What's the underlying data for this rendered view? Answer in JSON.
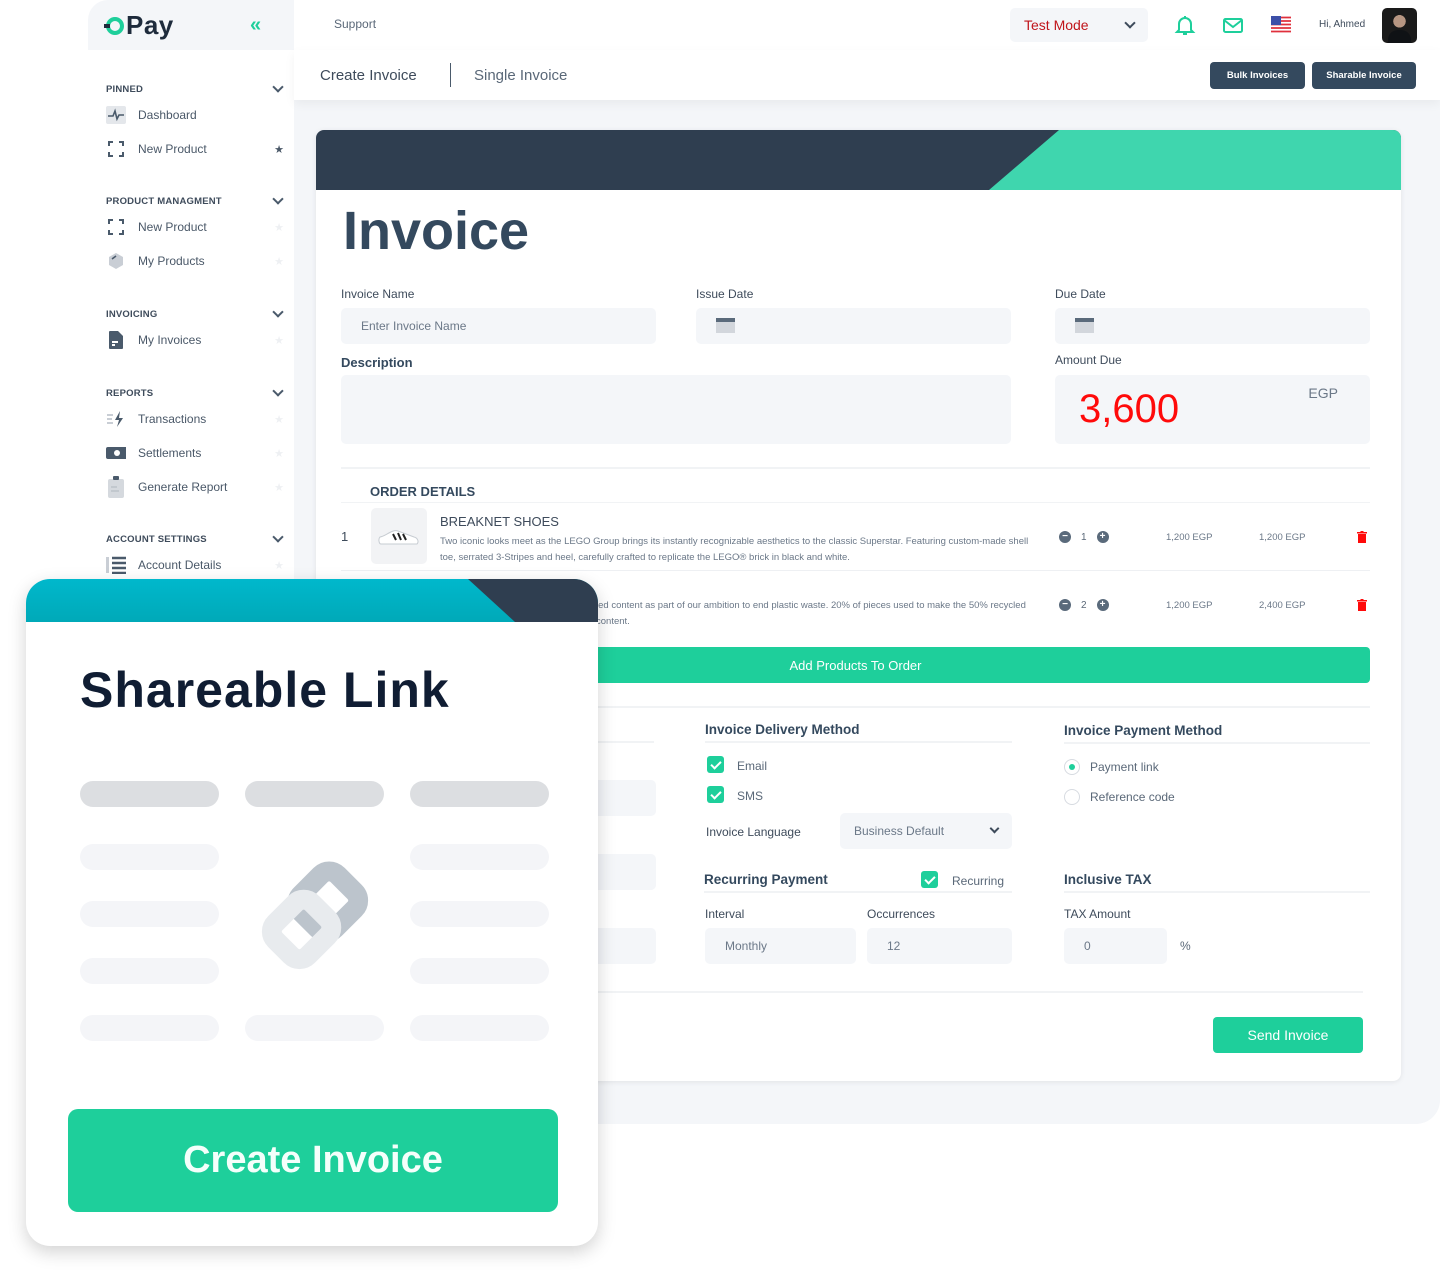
{
  "brand": {
    "name": "Pay",
    "accent": "#1ecf9b",
    "dark": "#2f3e50",
    "danger": "#ff0a0a"
  },
  "sidebar": {
    "collapse_icon": "double-chevron-left-icon",
    "sections": [
      {
        "title": "PINNED",
        "items": [
          {
            "label": "Dashboard",
            "icon": "pulse-icon",
            "pinned": true,
            "starred": false
          },
          {
            "label": "New Product",
            "icon": "scan-frame-icon",
            "pinned": true,
            "starred": true
          }
        ]
      },
      {
        "title": "PRODUCT MANAGMENT",
        "items": [
          {
            "label": "New Product",
            "icon": "scan-frame-icon",
            "starred": false
          },
          {
            "label": "My Products",
            "icon": "box-icon",
            "starred": false
          }
        ]
      },
      {
        "title": "INVOICING",
        "items": [
          {
            "label": "My Invoices",
            "icon": "document-icon",
            "starred": false
          }
        ]
      },
      {
        "title": "REPORTS",
        "items": [
          {
            "label": "Transactions",
            "icon": "lightning-icon",
            "starred": false
          },
          {
            "label": "Settlements",
            "icon": "cash-icon",
            "starred": false
          },
          {
            "label": "Generate Report",
            "icon": "clipboard-icon",
            "starred": false
          }
        ]
      },
      {
        "title": "ACCOUNT SETTINGS",
        "items": [
          {
            "label": "Account Details",
            "icon": "list-icon",
            "starred": false
          }
        ]
      }
    ]
  },
  "topbar": {
    "support_label": "Support",
    "mode": {
      "selected": "Test Mode",
      "color": "#c0151b"
    },
    "icons": [
      "bell-icon",
      "mail-icon",
      "us-flag-icon"
    ],
    "greeting": "Hi, Ahmed"
  },
  "page_header": {
    "breadcrumb": "Create Invoice",
    "sub_title": "Single Invoice",
    "buttons": {
      "bulk": "Bulk Invoices",
      "sharable": "Sharable Invoice"
    }
  },
  "invoice": {
    "title": "Invoice",
    "fields": {
      "invoice_name": {
        "label": "Invoice Name",
        "placeholder": "Enter Invoice Name",
        "value": ""
      },
      "issue_date": {
        "label": "Issue Date",
        "value": ""
      },
      "due_date": {
        "label": "Due Date",
        "value": ""
      },
      "description": {
        "label": "Description",
        "value": ""
      },
      "amount_due": {
        "label": "Amount Due",
        "value": "3,600",
        "currency": "EGP"
      }
    },
    "order": {
      "title": "ORDER DETAILS",
      "rows": [
        {
          "index": "1",
          "name": "BREAKNET SHOES",
          "description": "Two iconic looks meet as the LEGO Group brings its instantly recognizable aesthetics to the classic Superstar. Featuring custom-made shell toe, serrated 3-Stripes and heel, carefully crafted to replicate the LEGO® brick in black and white.",
          "quantity": "1",
          "unit_price": "1,200 EGP",
          "total": "1,200 EGP"
        },
        {
          "index": "",
          "name": "",
          "description": "led content as part of our ambition to end plastic waste. 20% of pieces used to make the 50% recycled content.",
          "quantity": "2",
          "unit_price": "1,200 EGP",
          "total": "2,400 EGP"
        }
      ],
      "add_button": "Add Products To Order"
    },
    "delivery": {
      "title": "Invoice Delivery Method",
      "options": [
        {
          "label": "Email",
          "checked": true
        },
        {
          "label": "SMS",
          "checked": true
        }
      ],
      "language_label": "Invoice Language",
      "language_value": "Business Default"
    },
    "payment": {
      "title": "Invoice Payment Method",
      "options": [
        {
          "label": "Payment link",
          "selected": true
        },
        {
          "label": "Reference code",
          "selected": false
        }
      ]
    },
    "recurring": {
      "title": "Recurring Payment",
      "toggle_label": "Recurring",
      "toggle_checked": true,
      "interval_label": "Interval",
      "interval_value": "Monthly",
      "occurrences_label": "Occurrences",
      "occurrences_value": "12"
    },
    "tax": {
      "title": "Inclusive TAX",
      "amount_label": "TAX Amount",
      "amount_value": "0",
      "unit": "%"
    },
    "send_button": "Send Invoice"
  },
  "share_card": {
    "title": "Shareable Link",
    "icon": "link-icon",
    "button": "Create Invoice"
  }
}
